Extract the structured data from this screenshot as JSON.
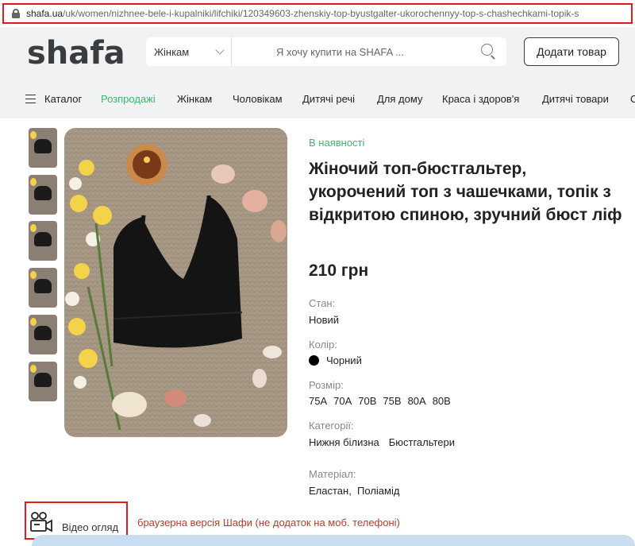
{
  "browser": {
    "url_host": "shafa.ua",
    "url_path": "/uk/women/nizhnee-bele-i-kupalniki/lifchiki/120349603-zhenskiy-top-byustgalter-ukorochennyy-top-s-chashechkami-topik-s"
  },
  "header": {
    "logo": "shafa",
    "search_category": "Жінкам",
    "search_placeholder": "Я хочу купити на SHAFA ...",
    "add_button": "Додати товар"
  },
  "nav": {
    "catalog": "Каталог",
    "items": [
      "Розпродажі",
      "Жінкам",
      "Чоловікам",
      "Дитячі речі",
      "Для дому",
      "Краса і здоров'я",
      "Дитячі товари",
      "С"
    ]
  },
  "product": {
    "availability": "В наявності",
    "title": "Жіночий топ-бюстгальтер, укорочений топ з чашечками, топік з відкритою спиною, зручний бюст ліф",
    "price": "210 грн",
    "condition_label": "Стан:",
    "condition": "Новий",
    "color_label": "Колір:",
    "color": "Чорний",
    "color_hex": "#000000",
    "size_label": "Розмір:",
    "sizes": [
      "75A",
      "70A",
      "70B",
      "75B",
      "80A",
      "80B"
    ],
    "category_label": "Категорії:",
    "categories": [
      "Нижня білизна",
      "Бюстгальтери"
    ],
    "material_label": "Матеріал:",
    "materials": "Еластан,  Поліамід"
  },
  "video": {
    "label": "Відео огляд",
    "icon": "video-camera-icon"
  },
  "annotation": "браузерна версія Шафи (не додаток на моб. телефоні)",
  "colors": {
    "accent_green": "#3fb36e",
    "highlight_red": "#e31b1b",
    "header_bg": "#f1f2f3"
  }
}
